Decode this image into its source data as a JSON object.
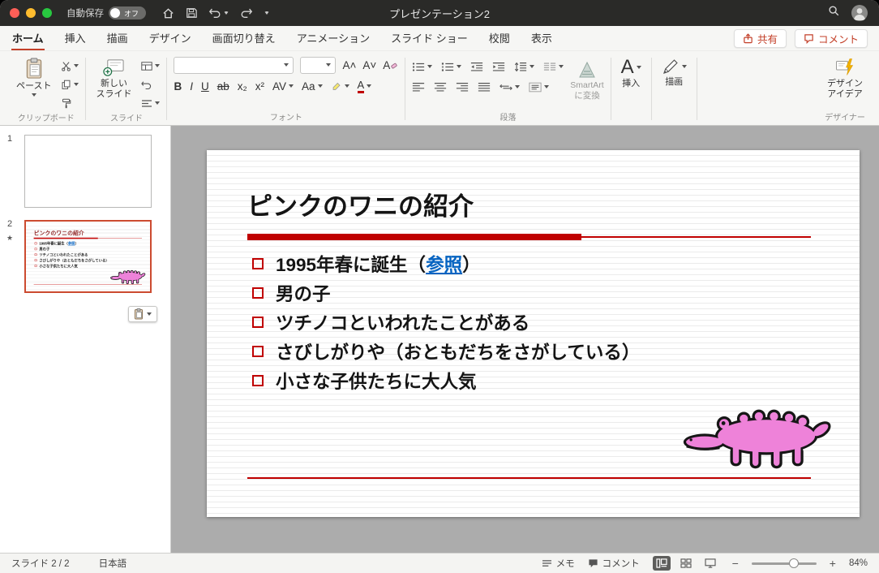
{
  "titlebar": {
    "title": "プレゼンテーション2",
    "autosave_label": "自動保存",
    "autosave_state": "オフ"
  },
  "tabbar": {
    "tabs": [
      {
        "label": "ホーム"
      },
      {
        "label": "挿入"
      },
      {
        "label": "描画"
      },
      {
        "label": "デザイン"
      },
      {
        "label": "画面切り替え"
      },
      {
        "label": "アニメーション"
      },
      {
        "label": "スライド ショー"
      },
      {
        "label": "校閲"
      },
      {
        "label": "表示"
      }
    ],
    "share_label": "共有",
    "comments_label": "コメント"
  },
  "ribbon": {
    "paste_label": "ペースト",
    "new_slide_line1": "新しい",
    "new_slide_line2": "スライド",
    "font_name_value": "",
    "font_size_value": "",
    "font_controls": {
      "bold": "B",
      "italic": "I",
      "underline": "U",
      "strike": "ab",
      "subscript": "x₂",
      "superscript": "x²",
      "spacing": "AV",
      "case": "Aa",
      "color": "A",
      "grow": "A˄",
      "shrink": "A˅"
    },
    "smartart_line1": "SmartArt",
    "smartart_line2": "に変換",
    "insert_label": "挿入",
    "draw_label": "描画",
    "design_line1": "デザイン",
    "design_line2": "アイデア",
    "groups": {
      "clipboard": "クリップボード",
      "slides": "スライド",
      "font": "フォント",
      "paragraph": "段落",
      "designer": "デザイナー"
    }
  },
  "sidebar": {
    "slides": [
      {
        "number": "1"
      },
      {
        "number": "2",
        "star": "★"
      }
    ]
  },
  "slide": {
    "title": "ピンクのワニの紹介",
    "bullets": [
      {
        "pre": "1995年春に誕生（",
        "link": "参照",
        "post": "）"
      },
      {
        "pre": "男の子"
      },
      {
        "pre": "ツチノコといわれたことがある"
      },
      {
        "pre": "さびしがりや（おともだちをさがしている）"
      },
      {
        "pre": "小さな子供たちに大人気"
      }
    ],
    "accent_color": "#c00000",
    "link_color": "#0563c1",
    "croc_color": "#ee82d9"
  },
  "statusbar": {
    "slide_indicator": "スライド 2 / 2",
    "language": "日本語",
    "notes_label": "メモ",
    "comments_label": "コメント",
    "zoom_level": "84%"
  }
}
